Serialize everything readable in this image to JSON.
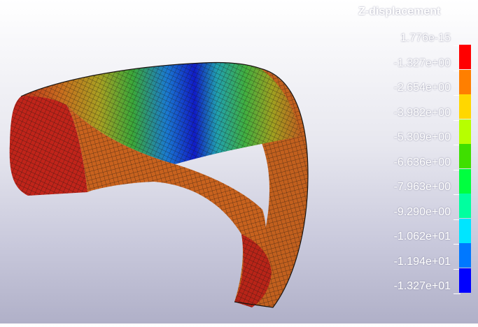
{
  "legend": {
    "title": "Z-displacement",
    "labels": [
      "1.776e-15",
      "-1.327e+00",
      "-2.654e+00",
      "-3.982e+00",
      "-5.309e+00",
      "-6.636e+00",
      "-7.963e+00",
      "-9.290e+00",
      "-1.062e+01",
      "-1.194e+01",
      "-1.327e+01"
    ],
    "colors": [
      "#ff0000",
      "#ff7f00",
      "#ffd700",
      "#b7ff00",
      "#3fdf00",
      "#00ff3f",
      "#00ff9f",
      "#00e5ff",
      "#0078ff",
      "#0000ff"
    ]
  },
  "colors": {
    "red": "#c0201a",
    "orange": "#c8601e",
    "yellow": "#b0a020",
    "green": "#3aa028",
    "cyan": "#20a0b0",
    "blue": "#1020c0",
    "mesh": "#1a1410"
  }
}
